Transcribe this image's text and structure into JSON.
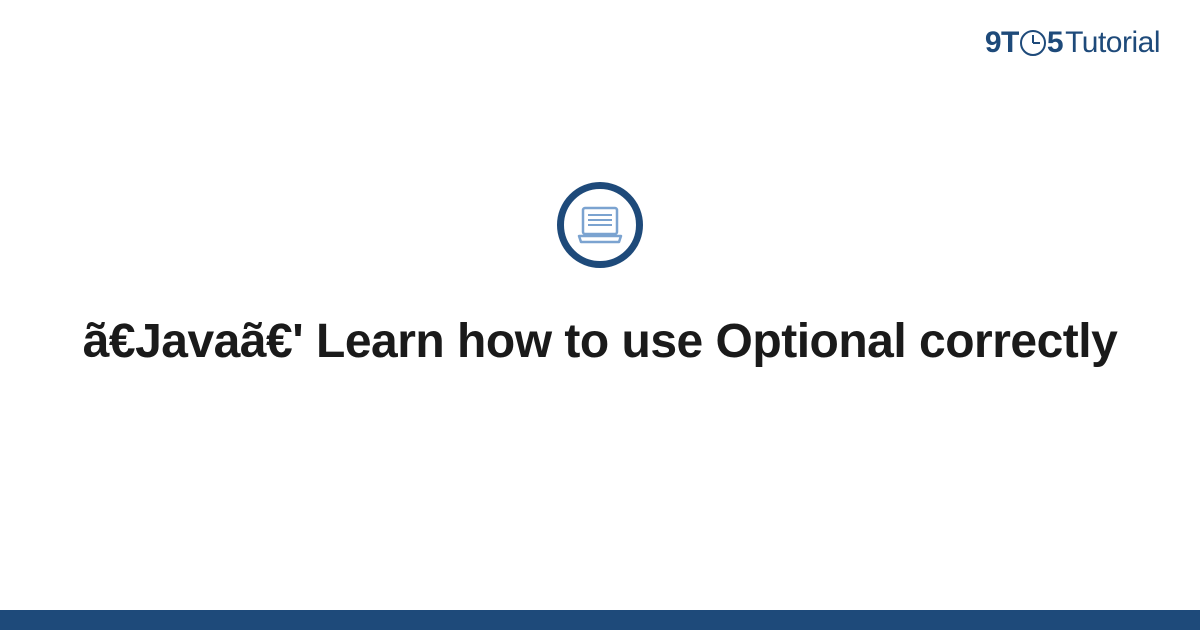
{
  "brand": {
    "part1": "9T",
    "part2": "5",
    "part3": "Tutorial"
  },
  "title": "ã€Javaã€' Learn how to use Optional correctly",
  "colors": {
    "primary": "#1e4a7a",
    "iconStroke": "#7ba3d0"
  }
}
